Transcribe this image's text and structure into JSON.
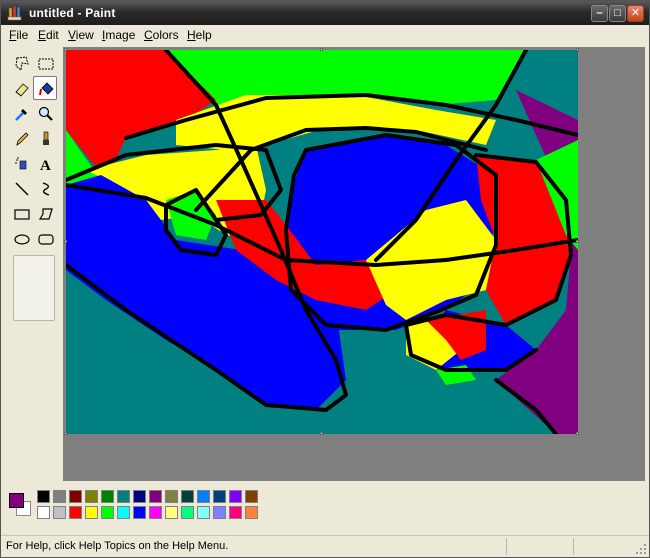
{
  "window": {
    "title": "untitled - Paint",
    "controls": {
      "minimize": "–",
      "maximize": "□",
      "close": "✕"
    }
  },
  "menu": [
    "File",
    "Edit",
    "View",
    "Image",
    "Colors",
    "Help"
  ],
  "tools": [
    {
      "name": "free-form-select-icon",
      "active": false
    },
    {
      "name": "select-icon",
      "active": false
    },
    {
      "name": "eraser-icon",
      "active": false
    },
    {
      "name": "fill-bucket-icon",
      "active": true
    },
    {
      "name": "pick-color-icon",
      "active": false
    },
    {
      "name": "magnifier-icon",
      "active": false
    },
    {
      "name": "pencil-icon",
      "active": false
    },
    {
      "name": "brush-icon",
      "active": false
    },
    {
      "name": "airbrush-icon",
      "active": false
    },
    {
      "name": "text-icon",
      "active": false
    },
    {
      "name": "line-icon",
      "active": false
    },
    {
      "name": "curve-icon",
      "active": false
    },
    {
      "name": "rectangle-icon",
      "active": false
    },
    {
      "name": "polygon-icon",
      "active": false
    },
    {
      "name": "ellipse-icon",
      "active": false
    },
    {
      "name": "rounded-rectangle-icon",
      "active": false
    }
  ],
  "text_tool_glyph": "A",
  "colors": {
    "foreground": "#800080",
    "background": "#ffffff",
    "canvas_bg": "#008080",
    "palette_top": [
      "#000000",
      "#808080",
      "#800000",
      "#808000",
      "#008000",
      "#008080",
      "#000080",
      "#800080",
      "#808040",
      "#004040",
      "#0080ff",
      "#004080",
      "#8000ff",
      "#804000"
    ],
    "palette_bottom": [
      "#ffffff",
      "#c0c0c0",
      "#ff0000",
      "#ffff00",
      "#00ff00",
      "#00ffff",
      "#0000ff",
      "#ff00ff",
      "#ffff80",
      "#00ff80",
      "#80ffff",
      "#8080ff",
      "#ff0080",
      "#ff8040"
    ]
  },
  "status": {
    "help_text": "For Help, click Help Topics on the Help Menu."
  }
}
